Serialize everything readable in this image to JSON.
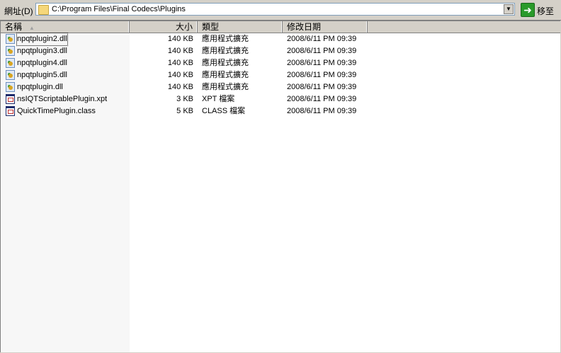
{
  "address_bar": {
    "label": "網址(D)",
    "path": "C:\\Program Files\\Final Codecs\\Plugins",
    "go_label": "移至"
  },
  "columns": {
    "name": "名稱",
    "size": "大小",
    "type": "類型",
    "modified": "修改日期"
  },
  "files": [
    {
      "name": "npqtplugin2.dll",
      "size": "140 KB",
      "type": "應用程式擴充",
      "modified": "2008/6/11 PM 09:39",
      "icon": "dll"
    },
    {
      "name": "npqtplugin3.dll",
      "size": "140 KB",
      "type": "應用程式擴充",
      "modified": "2008/6/11 PM 09:39",
      "icon": "dll"
    },
    {
      "name": "npqtplugin4.dll",
      "size": "140 KB",
      "type": "應用程式擴充",
      "modified": "2008/6/11 PM 09:39",
      "icon": "dll"
    },
    {
      "name": "npqtplugin5.dll",
      "size": "140 KB",
      "type": "應用程式擴充",
      "modified": "2008/6/11 PM 09:39",
      "icon": "dll"
    },
    {
      "name": "npqtplugin.dll",
      "size": "140 KB",
      "type": "應用程式擴充",
      "modified": "2008/6/11 PM 09:39",
      "icon": "dll"
    },
    {
      "name": "nsIQTScriptablePlugin.xpt",
      "size": "3 KB",
      "type": "XPT 檔案",
      "modified": "2008/6/11 PM 09:39",
      "icon": "gen"
    },
    {
      "name": "QuickTimePlugin.class",
      "size": "5 KB",
      "type": "CLASS 檔案",
      "modified": "2008/6/11 PM 09:39",
      "icon": "gen"
    }
  ]
}
